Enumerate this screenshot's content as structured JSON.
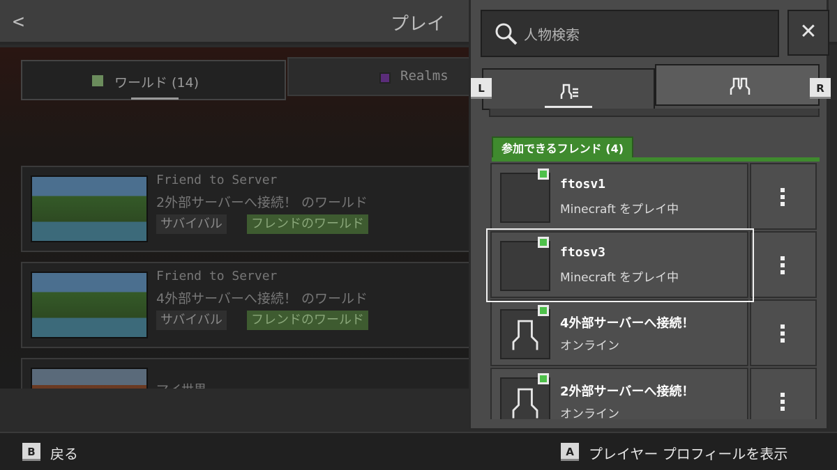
{
  "screen": {
    "title": "プレイ"
  },
  "world_tabs": [
    {
      "label": "ワールド (14)"
    },
    {
      "label": "Realms"
    }
  ],
  "worlds": [
    {
      "name": "Friend to Server",
      "desc": "2外部サーバーへ接続！ のワールド",
      "mode": "サバイバル",
      "tag": "フレンドのワールド"
    },
    {
      "name": "Friend to Server",
      "desc": "4外部サーバーへ接続！ のワールド",
      "mode": "サバイバル",
      "tag": "フレンドのワールド"
    },
    {
      "name": "マイ世界"
    }
  ],
  "panel": {
    "search_placeholder": "人物検索",
    "close_icon": "close-icon",
    "shoulder_left": "L",
    "shoulder_right": "R",
    "tabs": [
      {
        "icon": "friends-list-icon"
      },
      {
        "icon": "party-icon"
      }
    ],
    "section_title": "参加できるフレンド (4)",
    "friends": [
      {
        "name": "ftosv1",
        "status": "Minecraft をプレイ中",
        "avatar": "blank"
      },
      {
        "name": "ftosv3",
        "status": "Minecraft をプレイ中",
        "avatar": "blank"
      },
      {
        "name": "4外部サーバーへ接続！",
        "status": "オンライン",
        "avatar": "silhouette"
      },
      {
        "name": "2外部サーバーへ接続！",
        "status": "オンライン",
        "avatar": "silhouette"
      }
    ],
    "colors": {
      "online": "#4ec04a",
      "section": "#3f8a2e"
    }
  },
  "footer": {
    "back_glyph": "B",
    "back_label": "戻る",
    "profile_glyph": "A",
    "profile_label": "プレイヤー プロフィールを表示"
  }
}
